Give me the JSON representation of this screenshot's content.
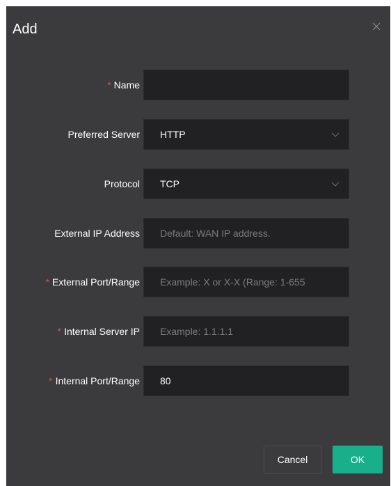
{
  "dialog": {
    "title": "Add",
    "close_icon": "close-icon"
  },
  "fields": {
    "name": {
      "label": "Name",
      "required": true,
      "value": "",
      "placeholder": ""
    },
    "preferred_server": {
      "label": "Preferred Server",
      "required": false,
      "value": "HTTP",
      "icon": "chevron-down-icon"
    },
    "protocol": {
      "label": "Protocol",
      "required": false,
      "value": "TCP",
      "icon": "chevron-down-icon"
    },
    "external_ip": {
      "label": "External IP Address",
      "required": false,
      "value": "",
      "placeholder": "Default: WAN IP address."
    },
    "external_port": {
      "label": "External Port/Range",
      "required": true,
      "value": "",
      "placeholder": "Example: X or X-X (Range: 1-655"
    },
    "internal_ip": {
      "label": "Internal Server IP",
      "required": true,
      "value": "",
      "placeholder": "Example: 1.1.1.1"
    },
    "internal_port": {
      "label": "Internal Port/Range",
      "required": true,
      "value": "80",
      "placeholder": ""
    }
  },
  "footer": {
    "cancel_label": "Cancel",
    "ok_label": "OK"
  },
  "colors": {
    "dialog_bg": "#3b3b3d",
    "field_bg": "#212123",
    "required_star": "#e5484d",
    "primary": "#1aaf8b"
  }
}
